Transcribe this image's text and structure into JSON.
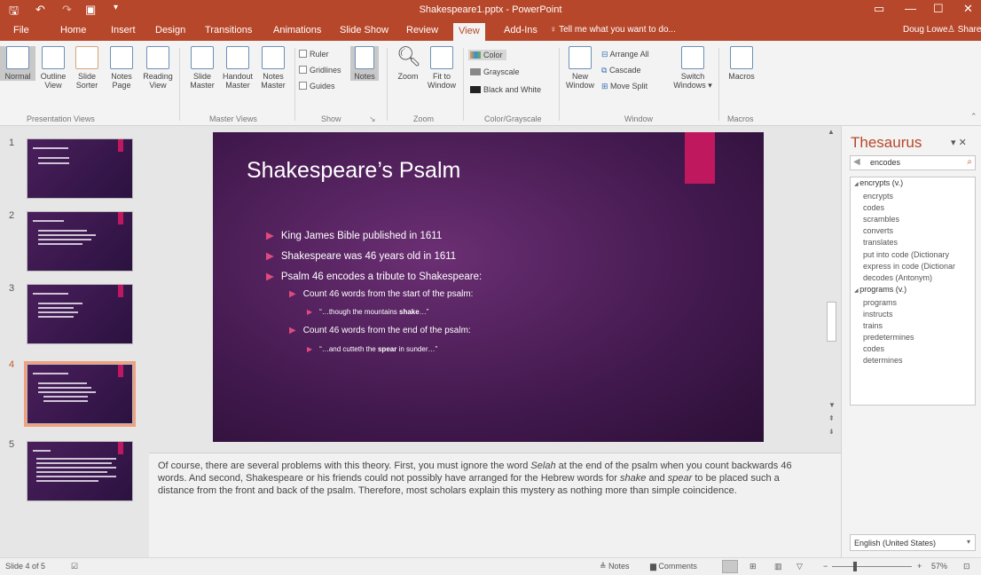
{
  "titlebar": {
    "title": "Shakespeare1.pptx - PowerPoint",
    "save_icon": "save-icon",
    "undo_icon": "undo-icon",
    "redo_icon": "redo-icon",
    "present_icon": "from-beginning-icon"
  },
  "tabs": [
    "File",
    "Home",
    "Insert",
    "Design",
    "Transitions",
    "Animations",
    "Slide Show",
    "Review",
    "View",
    "Add-Ins"
  ],
  "active_tab": "View",
  "tellme": "Tell me what you want to do...",
  "user": "Doug Lowe",
  "share": "Share",
  "ribbon": {
    "presentation_views": {
      "label": "Presentation Views",
      "items": [
        {
          "l1": "Normal",
          "l2": ""
        },
        {
          "l1": "Outline",
          "l2": "View"
        },
        {
          "l1": "Slide",
          "l2": "Sorter"
        },
        {
          "l1": "Notes",
          "l2": "Page"
        },
        {
          "l1": "Reading",
          "l2": "View"
        }
      ]
    },
    "master_views": {
      "label": "Master Views",
      "items": [
        {
          "l1": "Slide",
          "l2": "Master"
        },
        {
          "l1": "Handout",
          "l2": "Master"
        },
        {
          "l1": "Notes",
          "l2": "Master"
        }
      ]
    },
    "show": {
      "label": "Show",
      "ruler": "Ruler",
      "gridlines": "Gridlines",
      "guides": "Guides",
      "notes": "Notes"
    },
    "zoom": {
      "label": "Zoom",
      "zoom": "Zoom",
      "fit1": "Fit to",
      "fit2": "Window"
    },
    "color": {
      "label": "Color/Grayscale",
      "color": "Color",
      "gray": "Grayscale",
      "bw": "Black and White"
    },
    "window": {
      "label": "Window",
      "new1": "New",
      "new2": "Window",
      "arrange": "Arrange All",
      "cascade": "Cascade",
      "split": "Move Split",
      "switch1": "Switch",
      "switch2": "Windows"
    },
    "macros": {
      "label": "Macros",
      "macros": "Macros"
    }
  },
  "thumb_numbers": [
    "1",
    "2",
    "3",
    "4",
    "5"
  ],
  "slide": {
    "title": "Shakespeare’s Psalm",
    "b1": "King James Bible published in 1611",
    "b2": "Shakespeare was 46 years old in 1611",
    "b3": "Psalm 46 encodes a tribute to Shakespeare:",
    "b4": "Count 46 words from the start of the psalm:",
    "b5a": "“…though the mountains ",
    "b5b": "shake",
    "b5c": "…”",
    "b6": "Count 46 words from the end of the psalm:",
    "b7a": "“…and cutteth the ",
    "b7b": "spear",
    "b7c": " in sunder…”"
  },
  "notes": {
    "p1": "Of course, there are several problems with this theory. First, you must ignore the word ",
    "e1": "Selah",
    "p2": " at the end of the psalm when you count backwards 46 words. And second, Shakespeare or his friends could not possibly have arranged for the Hebrew words for ",
    "e2": "shake",
    "p3": " and ",
    "e3": "spear",
    "p4": " to be placed such a distance from the front and back of the psalm. Therefore, most scholars explain this mystery as nothing more than simple coincidence."
  },
  "thesaurus": {
    "title": "Thesaurus",
    "search": "encodes",
    "items": [
      {
        "t": "encrypts (v.)",
        "h": true
      },
      {
        "t": "encrypts",
        "h": false
      },
      {
        "t": "codes",
        "h": false
      },
      {
        "t": "scrambles",
        "h": false
      },
      {
        "t": "converts",
        "h": false
      },
      {
        "t": "translates",
        "h": false
      },
      {
        "t": "put into code (Dictionary",
        "h": false
      },
      {
        "t": "express in code (Dictionar",
        "h": false
      },
      {
        "t": "decodes (Antonym)",
        "h": false
      },
      {
        "t": "programs (v.)",
        "h": true
      },
      {
        "t": "programs",
        "h": false
      },
      {
        "t": "instructs",
        "h": false
      },
      {
        "t": "trains",
        "h": false
      },
      {
        "t": "predetermines",
        "h": false
      },
      {
        "t": "codes",
        "h": false
      },
      {
        "t": "determines",
        "h": false
      }
    ],
    "language": "English (United States)"
  },
  "status": {
    "slide": "Slide 4 of 5",
    "notes": "Notes",
    "comments": "Comments",
    "zoom": "57%"
  },
  "zoom_level": 0.57
}
